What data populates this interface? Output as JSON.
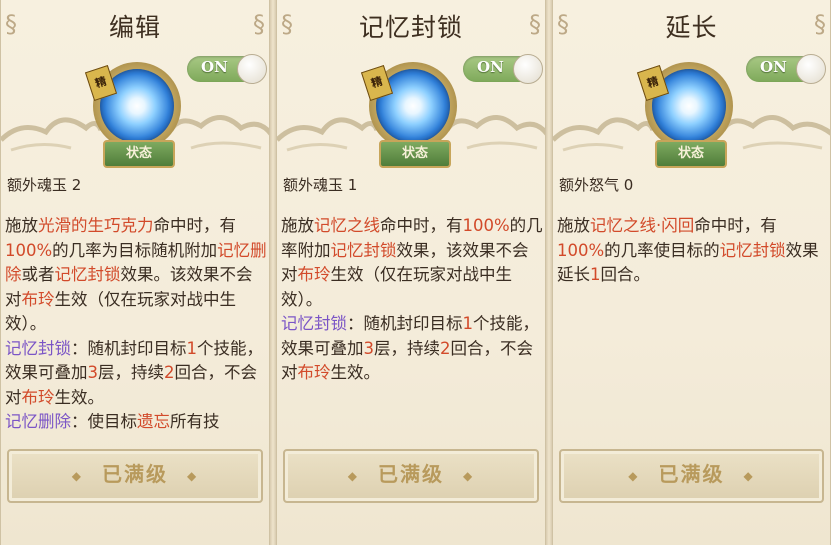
{
  "toggle_label": "ON",
  "emblem": {
    "badge_text": "精",
    "status_text": "状态"
  },
  "button": {
    "label": "已满级",
    "diamond": "◆"
  },
  "cards": [
    {
      "title": "编辑",
      "extra": "额外魂玉 2",
      "desc": [
        [
          {
            "t": "施放",
            "c": ""
          },
          {
            "t": "光滑的生巧克力",
            "c": "red"
          },
          {
            "t": "命中时，有",
            "c": ""
          },
          {
            "t": "100%",
            "c": "red"
          },
          {
            "t": "的几率为目标随机附加",
            "c": ""
          },
          {
            "t": "记忆删除",
            "c": "red"
          },
          {
            "t": "或者",
            "c": ""
          },
          {
            "t": "记忆封锁",
            "c": "red"
          },
          {
            "t": "效果。该效果不会对",
            "c": ""
          },
          {
            "t": "布玲",
            "c": "red"
          },
          {
            "t": "生效（仅在玩家对战中生效）。",
            "c": ""
          }
        ],
        [
          {
            "t": "记忆封锁",
            "c": "purple"
          },
          {
            "t": "：随机封印目标",
            "c": ""
          },
          {
            "t": "1",
            "c": "red"
          },
          {
            "t": "个技能，效果可叠加",
            "c": ""
          },
          {
            "t": "3",
            "c": "red"
          },
          {
            "t": "层，持续",
            "c": ""
          },
          {
            "t": "2",
            "c": "red"
          },
          {
            "t": "回合，不会对",
            "c": ""
          },
          {
            "t": "布玲",
            "c": "red"
          },
          {
            "t": "生效。",
            "c": ""
          }
        ],
        [
          {
            "t": "记忆删除",
            "c": "purple"
          },
          {
            "t": "：使目标",
            "c": ""
          },
          {
            "t": "遗忘",
            "c": "red"
          },
          {
            "t": "所有技",
            "c": ""
          }
        ]
      ]
    },
    {
      "title": "记忆封锁",
      "extra": "额外魂玉 1",
      "desc": [
        [
          {
            "t": "施放",
            "c": ""
          },
          {
            "t": "记忆之线",
            "c": "red"
          },
          {
            "t": "命中时，有",
            "c": ""
          },
          {
            "t": "100%",
            "c": "red"
          },
          {
            "t": "的几率附加",
            "c": ""
          },
          {
            "t": "记忆封锁",
            "c": "red"
          },
          {
            "t": "效果，该效果不会对",
            "c": ""
          },
          {
            "t": "布玲",
            "c": "red"
          },
          {
            "t": "生效（仅在玩家对战中生效）。",
            "c": ""
          }
        ],
        [
          {
            "t": "记忆封锁",
            "c": "purple"
          },
          {
            "t": "：随机封印目标",
            "c": ""
          },
          {
            "t": "1",
            "c": "red"
          },
          {
            "t": "个技能，效果可叠加",
            "c": ""
          },
          {
            "t": "3",
            "c": "red"
          },
          {
            "t": "层，持续",
            "c": ""
          },
          {
            "t": "2",
            "c": "red"
          },
          {
            "t": "回合，不会对",
            "c": ""
          },
          {
            "t": "布玲",
            "c": "red"
          },
          {
            "t": "生效。",
            "c": ""
          }
        ]
      ]
    },
    {
      "title": "延长",
      "extra": "额外怒气 0",
      "desc": [
        [
          {
            "t": "施放",
            "c": ""
          },
          {
            "t": "记忆之线·闪回",
            "c": "red"
          },
          {
            "t": "命中时，有",
            "c": ""
          },
          {
            "t": "100%",
            "c": "red"
          },
          {
            "t": "的几率使目标的",
            "c": ""
          },
          {
            "t": "记忆封锁",
            "c": "red"
          },
          {
            "t": "效果延长",
            "c": ""
          },
          {
            "t": "1",
            "c": "red"
          },
          {
            "t": "回合。",
            "c": ""
          }
        ]
      ]
    }
  ]
}
